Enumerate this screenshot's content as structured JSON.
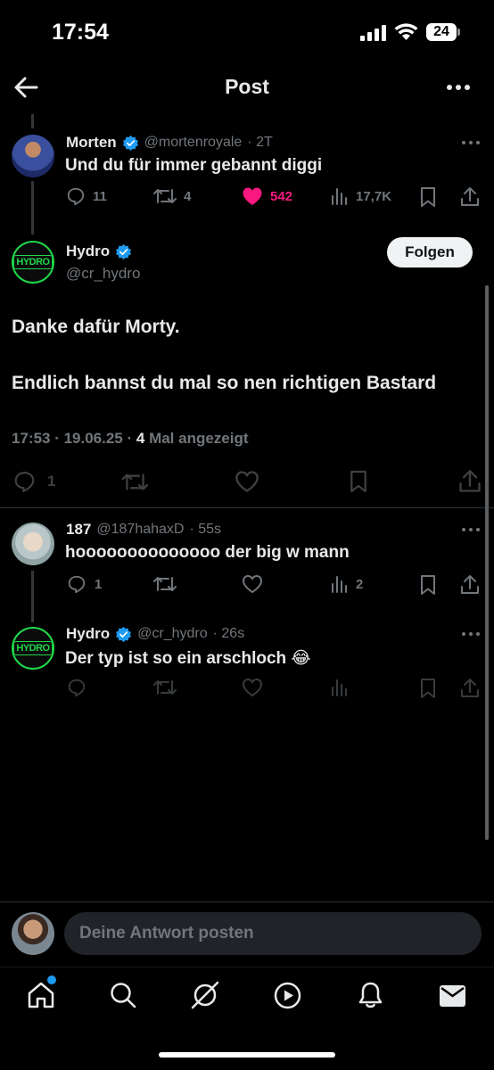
{
  "status_bar": {
    "time": "17:54",
    "battery": "24"
  },
  "header": {
    "title": "Post"
  },
  "parent_tweet": {
    "name": "Morten",
    "handle": "@mortenroyale",
    "time": "· 2T",
    "text": "Und du für immer gebannt diggi",
    "replies": "11",
    "retweets": "4",
    "likes": "542",
    "views": "17,7K",
    "like_color": "#f91880"
  },
  "main_tweet": {
    "name": "Hydro",
    "handle": "@cr_hydro",
    "avatar_text": "HYDRO",
    "follow_label": "Folgen",
    "line1": "Danke dafür Morty.",
    "line2": "Endlich bannst du mal so nen richtigen Bastard",
    "meta_time": "17:53 · 19.06.25 · ",
    "meta_count": "4",
    "meta_suffix": " Mal angezeigt",
    "replies": "1"
  },
  "replies": [
    {
      "name": "187",
      "handle": "@187hahaxD",
      "time": "· 55s",
      "text": "hoooooooooooooo der big w mann",
      "replies": "1",
      "views": "2"
    },
    {
      "name": "Hydro",
      "handle": "@cr_hydro",
      "time": "· 26s",
      "text": "Der typ ist so ein arschloch 😂",
      "avatar_text": "HYDRO"
    }
  ],
  "composer": {
    "placeholder": "Deine Antwort posten"
  },
  "colors": {
    "verified": "#1d9bf0",
    "accent_green": "#1fd84a",
    "notification_dot": "#1d9bf0"
  },
  "tab_bar": {
    "icons": [
      "home-icon",
      "search-icon",
      "grok-icon",
      "video-icon",
      "bell-icon",
      "mail-icon"
    ]
  }
}
